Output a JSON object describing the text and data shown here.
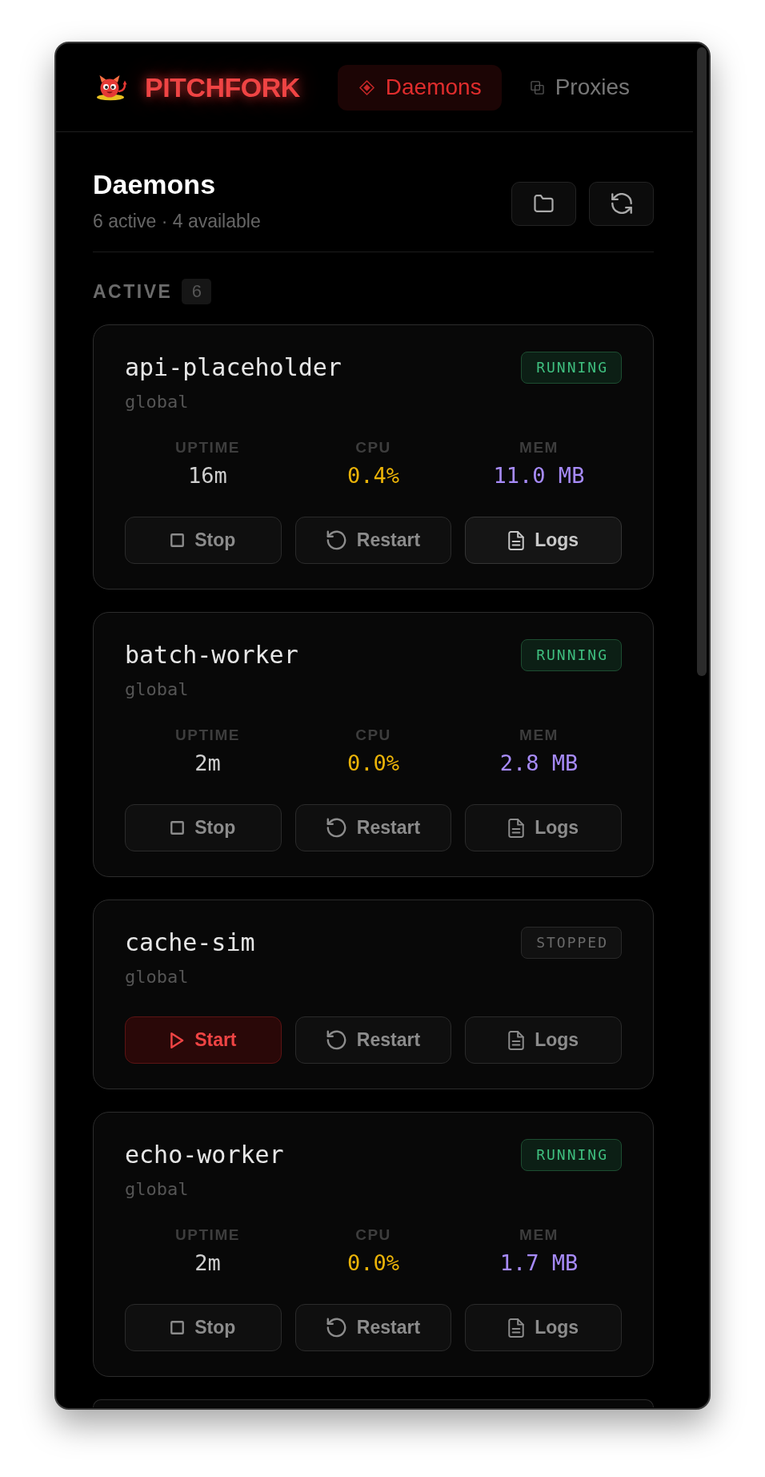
{
  "header": {
    "logo": "PITCHFORK",
    "tabs": [
      {
        "label": "Daemons",
        "kind": "daemons",
        "selected": true
      },
      {
        "label": "Proxies",
        "kind": "proxies",
        "selected": false
      }
    ]
  },
  "page": {
    "title": "Daemons",
    "subtitle": "6 active · 4 available",
    "tools": [
      {
        "kind": "browse"
      },
      {
        "kind": "reload"
      }
    ]
  },
  "section": {
    "label": "ACTIVE",
    "count": "6"
  },
  "daemons": [
    {
      "name": "api-placeholder",
      "scope": "global",
      "partial": false,
      "status": {
        "label": "RUNNING",
        "kind": "running"
      },
      "stats": [
        {
          "label": "UPTIME",
          "value": "16m",
          "kind": "uptime"
        },
        {
          "label": "CPU",
          "value": "0.4%",
          "kind": "cpu"
        },
        {
          "label": "MEM",
          "value": "11.0 MB",
          "kind": "mem"
        }
      ],
      "actions": [
        {
          "label": "Stop",
          "kind": "stop",
          "highlighted": false
        },
        {
          "label": "Restart",
          "kind": "restart",
          "highlighted": false
        },
        {
          "label": "Logs",
          "kind": "logs",
          "highlighted": true
        }
      ]
    },
    {
      "name": "batch-worker",
      "scope": "global",
      "partial": false,
      "status": {
        "label": "RUNNING",
        "kind": "running"
      },
      "stats": [
        {
          "label": "UPTIME",
          "value": "2m",
          "kind": "uptime"
        },
        {
          "label": "CPU",
          "value": "0.0%",
          "kind": "cpu"
        },
        {
          "label": "MEM",
          "value": "2.8 MB",
          "kind": "mem"
        }
      ],
      "actions": [
        {
          "label": "Stop",
          "kind": "stop",
          "highlighted": false
        },
        {
          "label": "Restart",
          "kind": "restart",
          "highlighted": false
        },
        {
          "label": "Logs",
          "kind": "logs",
          "highlighted": false
        }
      ]
    },
    {
      "name": "cache-sim",
      "scope": "global",
      "partial": false,
      "status": {
        "label": "STOPPED",
        "kind": "stopped"
      },
      "actions": [
        {
          "label": "Start",
          "kind": "start",
          "highlighted": false
        },
        {
          "label": "Restart",
          "kind": "restart",
          "highlighted": false
        },
        {
          "label": "Logs",
          "kind": "logs",
          "highlighted": false
        }
      ]
    },
    {
      "name": "echo-worker",
      "scope": "global",
      "partial": false,
      "status": {
        "label": "RUNNING",
        "kind": "running"
      },
      "stats": [
        {
          "label": "UPTIME",
          "value": "2m",
          "kind": "uptime"
        },
        {
          "label": "CPU",
          "value": "0.0%",
          "kind": "cpu"
        },
        {
          "label": "MEM",
          "value": "1.7 MB",
          "kind": "mem"
        }
      ],
      "actions": [
        {
          "label": "Stop",
          "kind": "stop",
          "highlighted": false
        },
        {
          "label": "Restart",
          "kind": "restart",
          "highlighted": false
        },
        {
          "label": "Logs",
          "kind": "logs",
          "highlighted": false
        }
      ]
    },
    {
      "partial": true
    }
  ]
}
